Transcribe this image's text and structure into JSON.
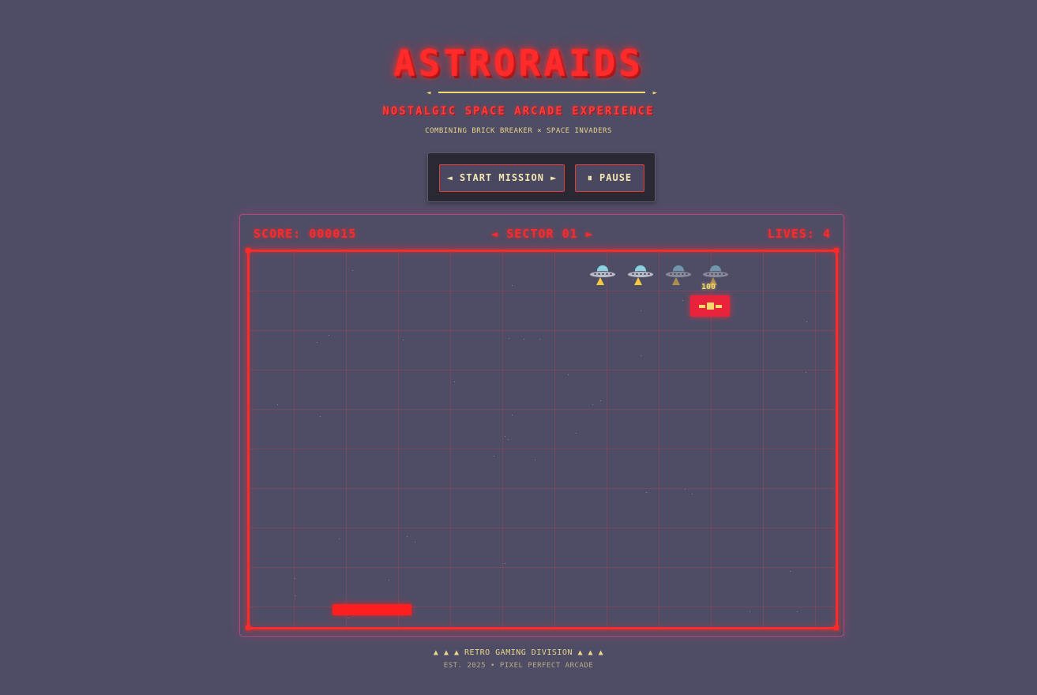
{
  "header": {
    "title": "ASTRORAIDS",
    "divider_left": "◄",
    "divider_right": "►",
    "subtitle": "NOSTALGIC SPACE ARCADE EXPERIENCE",
    "tagline": "COMBINING BRICK BREAKER × SPACE INVADERS"
  },
  "controls": {
    "start_label": "◄ START MISSION ►",
    "pause_label": "⏸ PAUSE"
  },
  "hud": {
    "score": "SCORE: 000015",
    "sector": "◄ SECTOR 01 ►",
    "lives": "LIVES: 4"
  },
  "game": {
    "invaders": [
      {
        "icon": "ufo-icon",
        "state": "active"
      },
      {
        "icon": "ufo-icon",
        "state": "active"
      },
      {
        "icon": "ufo-icon",
        "state": "dim"
      },
      {
        "icon": "ufo-icon",
        "state": "dim"
      }
    ],
    "points_popup": "100",
    "colors": {
      "accent": "#ff2a2a",
      "gold": "#f5d96a",
      "background": "#4f4d66",
      "brick": "#e8223a"
    }
  },
  "footer": {
    "line1": "▲ ▲ ▲ RETRO GAMING DIVISION ▲ ▲ ▲",
    "line2": "EST. 2025 • PIXEL PERFECT ARCADE"
  }
}
